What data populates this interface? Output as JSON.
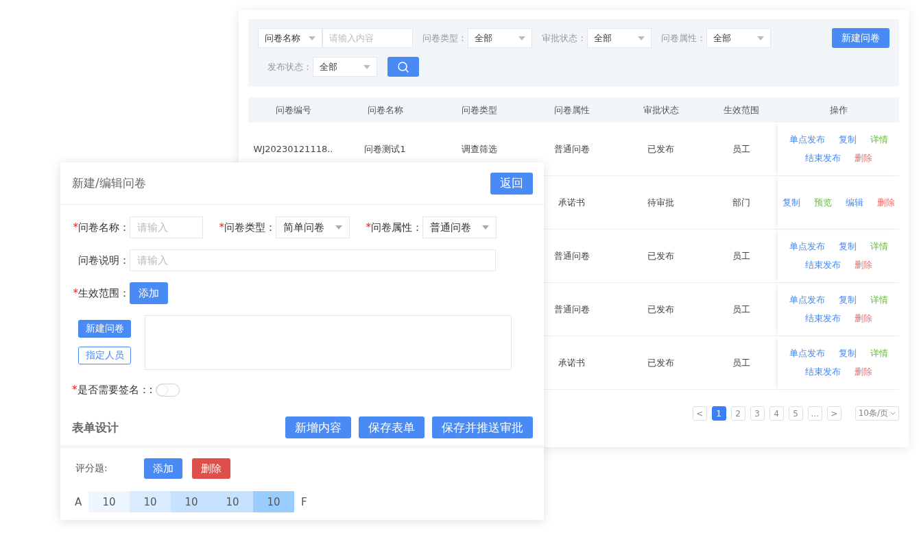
{
  "list_panel": {
    "search": {
      "field": "问卷名称",
      "placeholder": "请输入内容"
    },
    "filters": [
      {
        "label": "问卷类型：",
        "value": "全部"
      },
      {
        "label": "审批状态：",
        "value": "全部"
      },
      {
        "label": "问卷属性：",
        "value": "全部"
      },
      {
        "label": "发布状态：",
        "value": "全部"
      }
    ],
    "new_button": "新建问卷",
    "table": {
      "columns": [
        "问卷编号",
        "问卷名称",
        "问卷类型",
        "问卷属性",
        "审批状态",
        "生效范围",
        "操作"
      ],
      "rows": [
        {
          "number": "WJ20230121118..",
          "name": "问卷测试1",
          "type": "调查筛选",
          "attribute": "普通问卷",
          "approval": "已发布",
          "scope": "员工",
          "actions": [
            [
              {
                "label": "单点发布",
                "kind": "primary"
              },
              {
                "label": "复制",
                "kind": "primary"
              },
              {
                "label": "详情",
                "kind": "success"
              }
            ],
            [
              {
                "label": "结束发布",
                "kind": "primary"
              },
              {
                "label": "删除",
                "kind": "danger"
              }
            ]
          ]
        },
        {
          "attribute": "承诺书",
          "approval": "待审批",
          "scope": "部门",
          "actions": [
            [
              {
                "label": "复制",
                "kind": "primary"
              },
              {
                "label": "预览",
                "kind": "success"
              },
              {
                "label": "编辑",
                "kind": "primary"
              },
              {
                "label": "删除",
                "kind": "danger"
              }
            ]
          ]
        },
        {
          "attribute": "普通问卷",
          "approval": "已发布",
          "scope": "员工",
          "actions": [
            [
              {
                "label": "单点发布",
                "kind": "primary"
              },
              {
                "label": "复制",
                "kind": "primary"
              },
              {
                "label": "详情",
                "kind": "success"
              }
            ],
            [
              {
                "label": "结束发布",
                "kind": "primary"
              },
              {
                "label": "删除",
                "kind": "danger"
              }
            ]
          ]
        },
        {
          "attribute": "普通问卷",
          "approval": "已发布",
          "scope": "员工",
          "actions": [
            [
              {
                "label": "单点发布",
                "kind": "primary"
              },
              {
                "label": "复制",
                "kind": "primary"
              },
              {
                "label": "详情",
                "kind": "success"
              }
            ],
            [
              {
                "label": "结束发布",
                "kind": "primary"
              },
              {
                "label": "删除",
                "kind": "danger"
              }
            ]
          ]
        },
        {
          "attribute": "承诺书",
          "approval": "已发布",
          "scope": "员工",
          "actions": [
            [
              {
                "label": "单点发布",
                "kind": "primary"
              },
              {
                "label": "复制",
                "kind": "primary"
              },
              {
                "label": "详情",
                "kind": "success"
              }
            ],
            [
              {
                "label": "结束发布",
                "kind": "primary"
              },
              {
                "label": "删除",
                "kind": "danger"
              }
            ]
          ]
        }
      ]
    },
    "pagination": {
      "prev": "<",
      "pages": [
        {
          "label": "1",
          "selected": true
        },
        {
          "label": "2",
          "selected": false
        },
        {
          "label": "3",
          "selected": false
        },
        {
          "label": "4",
          "selected": false
        },
        {
          "label": "5",
          "selected": false
        },
        {
          "label": "...",
          "selected": false
        }
      ],
      "next": ">",
      "page_size": "10条/页"
    }
  },
  "edit_panel": {
    "title": "新建/编辑问卷",
    "back_button": "返回",
    "fields": [
      {
        "kind": "input",
        "mark": "*",
        "label": "问卷名称：",
        "placeholder": "请输入"
      },
      {
        "kind": "select",
        "mark": "*",
        "label": "问卷类型：",
        "value": "简单问卷"
      },
      {
        "kind": "select",
        "mark": "*",
        "label": "问卷属性：",
        "value": "普通问卷"
      }
    ],
    "description": {
      "label": "问卷说明：",
      "placeholder": "请输入"
    },
    "scope": {
      "mark": "*",
      "label": "生效范围：",
      "button": "添加",
      "options": [
        {
          "label": "新建问卷",
          "kind": "solid"
        },
        {
          "label": "指定人员",
          "kind": "outline"
        }
      ]
    },
    "signature": {
      "mark": "*",
      "label": "是否需要签名：:",
      "on": false
    },
    "form_design": {
      "title": "表单设计",
      "buttons": [
        "新增内容",
        "保存表单",
        "保存并推送审批"
      ]
    },
    "rating": {
      "label": "评分题:",
      "add_button": "添加",
      "delete_button": "删除",
      "start": "A",
      "end": "F",
      "cells": [
        {
          "value": "10",
          "color": "#eef6ff"
        },
        {
          "value": "10",
          "color": "#d9ecff"
        },
        {
          "value": "10",
          "color": "#c6e2ff"
        },
        {
          "value": "10",
          "color": "#c6e2ff"
        },
        {
          "value": "10",
          "color": "#99cdfd"
        }
      ]
    }
  }
}
